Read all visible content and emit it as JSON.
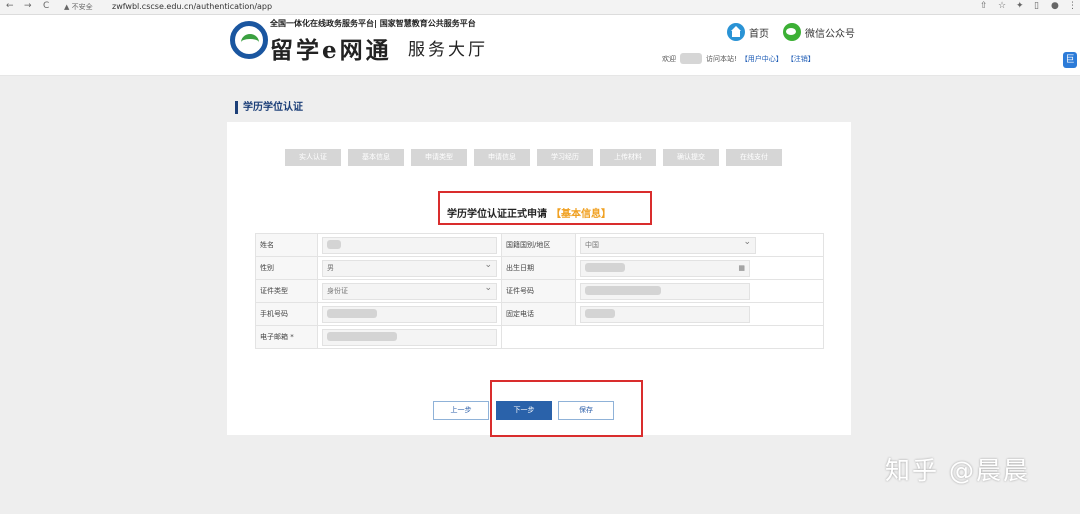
{
  "browser": {
    "back": "←",
    "forward": "→",
    "reload": "C",
    "security": "▲ 不安全",
    "url": "zwfwbl.cscse.edu.cn/authentication/app"
  },
  "header": {
    "platform_line": "全国一体化在线政务服务平台| 国家智慧教育公共服务平台",
    "brand": "留学e网通",
    "hall": "服务大厅",
    "home_label": "首页",
    "wechat_label": "微信公众号",
    "welcome_prefix": "欢迎",
    "welcome_suffix": "访问本站!",
    "user_center": "【用户中心】",
    "logout": "【注销】"
  },
  "side_tab": "巨",
  "section_title": "学历学位认证",
  "steps": [
    "实人认证",
    "基本信息",
    "申请类型",
    "申请信息",
    "学习经历",
    "上传材料",
    "确认提交",
    "在线支付"
  ],
  "form": {
    "heading": "学历学位认证正式申请",
    "heading_sub": "【基本信息】",
    "name_label": "姓名",
    "country_label": "国籍国别/地区",
    "country_value": "中国",
    "gender_label": "性别",
    "gender_value": "男",
    "birth_label": "出生日期",
    "id_type_label": "证件类型",
    "id_type_value": "身份证",
    "id_no_label": "证件号码",
    "mobile_label": "手机号码",
    "phone_label": "固定电话",
    "email_label": "电子邮箱 *"
  },
  "buttons": {
    "prev": "上一步",
    "next": "下一步",
    "save": "保存"
  },
  "watermark": "知乎 @晨晨",
  "colors": {
    "accent": "#2a62aa",
    "annotation_red": "#d92d2d",
    "highlight_orange": "#f0a020"
  }
}
